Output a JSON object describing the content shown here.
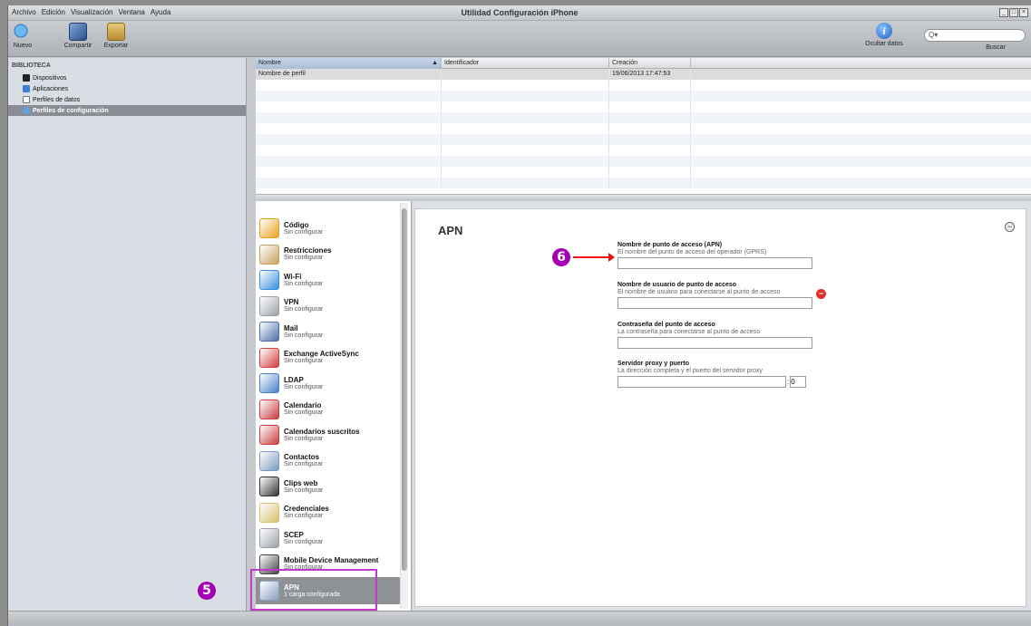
{
  "window": {
    "title": "Utilidad Configuración iPhone",
    "menu": [
      "Archivo",
      "Edición",
      "Visualización",
      "Ventana",
      "Ayuda"
    ]
  },
  "toolbar": {
    "new_label": "Nuevo",
    "share_label": "Compartir",
    "export_label": "Exportar",
    "hide_label": "Ocultar datos",
    "search_placeholder": "",
    "search_label": "Buscar"
  },
  "sidebar": {
    "section": "BIBLIOTECA",
    "items": [
      {
        "label": "Dispositivos",
        "icon": "device-icon"
      },
      {
        "label": "Aplicaciones",
        "icon": "app-icon"
      },
      {
        "label": "Perfiles de datos",
        "icon": "document-icon"
      },
      {
        "label": "Perfiles de configuración",
        "icon": "gear-icon"
      }
    ]
  },
  "table": {
    "columns": [
      "Nombre",
      "Identificador",
      "Creación"
    ],
    "rows": [
      {
        "name": "Nombre de perfil",
        "id": "",
        "date": "19/06/2013 17:47:53"
      }
    ]
  },
  "payloads": [
    {
      "title": "Código",
      "sub": "Sin configurar",
      "icon": "passcode-icon",
      "color": "#e8a020"
    },
    {
      "title": "Restricciones",
      "sub": "Sin configurar",
      "icon": "restrictions-icon",
      "color": "#c8a060"
    },
    {
      "title": "Wi-Fi",
      "sub": "Sin configurar",
      "icon": "wifi-icon",
      "color": "#3a8fe0"
    },
    {
      "title": "VPN",
      "sub": "Sin configurar",
      "icon": "vpn-icon",
      "color": "#9aa0a8"
    },
    {
      "title": "Mail",
      "sub": "Sin configurar",
      "icon": "mail-icon",
      "color": "#4a6ea8"
    },
    {
      "title": "Exchange ActiveSync",
      "sub": "Sin configurar",
      "icon": "exchange-icon",
      "color": "#d04040"
    },
    {
      "title": "LDAP",
      "sub": "Sin configurar",
      "icon": "ldap-icon",
      "color": "#4a80c8"
    },
    {
      "title": "Calendario",
      "sub": "Sin configurar",
      "icon": "calendar-icon",
      "color": "#c84040"
    },
    {
      "title": "Calendarios suscritos",
      "sub": "Sin configurar",
      "icon": "subscribed-calendar-icon",
      "color": "#c84040"
    },
    {
      "title": "Contactos",
      "sub": "Sin configurar",
      "icon": "contacts-icon",
      "color": "#7a9ac0"
    },
    {
      "title": "Clips web",
      "sub": "Sin configurar",
      "icon": "webclip-icon",
      "color": "#333333"
    },
    {
      "title": "Credenciales",
      "sub": "Sin configurar",
      "icon": "credentials-icon",
      "color": "#d8c070"
    },
    {
      "title": "SCEP",
      "sub": "Sin configurar",
      "icon": "scep-icon",
      "color": "#9aa0a8"
    },
    {
      "title": "Mobile Device Management",
      "sub": "Sin configurar",
      "icon": "mdm-icon",
      "color": "#444444"
    },
    {
      "title": "APN",
      "sub": "1 carga configurada",
      "icon": "apn-gear-icon",
      "color": "#8aa0c0"
    }
  ],
  "detail": {
    "title": "APN",
    "fields": [
      {
        "label": "Nombre de punto de acceso (APN)",
        "desc": "El nombre del punto de acceso del operador (GPRS)",
        "value": ""
      },
      {
        "label": "Nombre de usuario de punto de acceso",
        "desc": "El nombre de usuario para conectarse al punto de acceso",
        "value": ""
      },
      {
        "label": "Contraseña del punto de acceso",
        "desc": "La contraseña para conectarse al punto de acceso",
        "value": ""
      },
      {
        "label": "Servidor proxy y puerto",
        "desc": "La dirección completa y el puerto del servidor proxy",
        "value": "",
        "port": "0"
      }
    ]
  },
  "annotations": {
    "step5": "5",
    "step6": "6"
  }
}
